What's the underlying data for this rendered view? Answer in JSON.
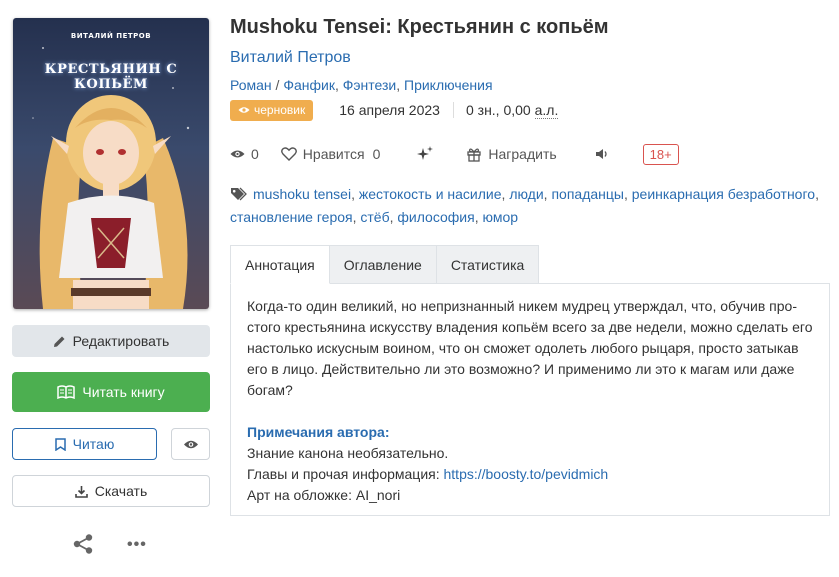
{
  "cover": {
    "author_text": "ВИТАЛИЙ ПЕТРОВ",
    "title_text": "КРЕСТЬЯНИН С КОПЬЁМ"
  },
  "left": {
    "edit_label": "Редактировать",
    "read_label": "Читать книгу",
    "reading_label": "Читаю",
    "download_label": "Скачать"
  },
  "book": {
    "title": "Mushoku Tensei: Крестьянин с копьём",
    "author": "Виталий Петров",
    "genres": [
      "Роман",
      "Фанфик",
      "Фэнтези",
      "Приключения"
    ],
    "status_badge": "черновик",
    "date": "16 апреля 2023",
    "size_prefix": "0 зн., 0,00",
    "size_unit": "а.л."
  },
  "actions": {
    "views": "0",
    "like_label": "Нравится",
    "likes": "0",
    "reward_label": "Наградить",
    "age_rating": "18+"
  },
  "tags": [
    "mushoku tensei",
    "жестокость и насилие",
    "люди",
    "попаданцы",
    "реинкарнация безработного",
    "становление героя",
    "стёб",
    "философия",
    "юмор"
  ],
  "tabs": [
    "Аннотация",
    "Оглавление",
    "Статистика"
  ],
  "annotation": {
    "text": "Когда-то один великий, но непризнанный никем мудрец утверждал, что, обучив про­стого крестьянина искусству владения копьём всего за две недели, можно сделать его настолько искусным воином, что он сможет одолеть любого рыцаря, просто затыкав его в лицо. Действительно ли это возможно? И применимо ли это к магам или даже богам?",
    "notes_title": "Примечания автора:",
    "note_1": "Знание канона необязательно.",
    "note_2_prefix": "Главы и прочая информация: ",
    "note_2_link": "https://boosty.to/pevidmich",
    "note_3": "Арт на обложке: AI_nori"
  },
  "colors": {
    "link": "#2a6cb0",
    "read_button": "#4caf50",
    "badge": "#f0ad4e",
    "age_rating": "#d9534f"
  },
  "icons": [
    "pencil-icon",
    "book-icon",
    "bookmark-icon",
    "eye-icon",
    "download-icon",
    "share-icon",
    "more-icon",
    "heart-icon",
    "sparkle-icon",
    "gift-icon",
    "speaker-icon",
    "tag-icon"
  ]
}
